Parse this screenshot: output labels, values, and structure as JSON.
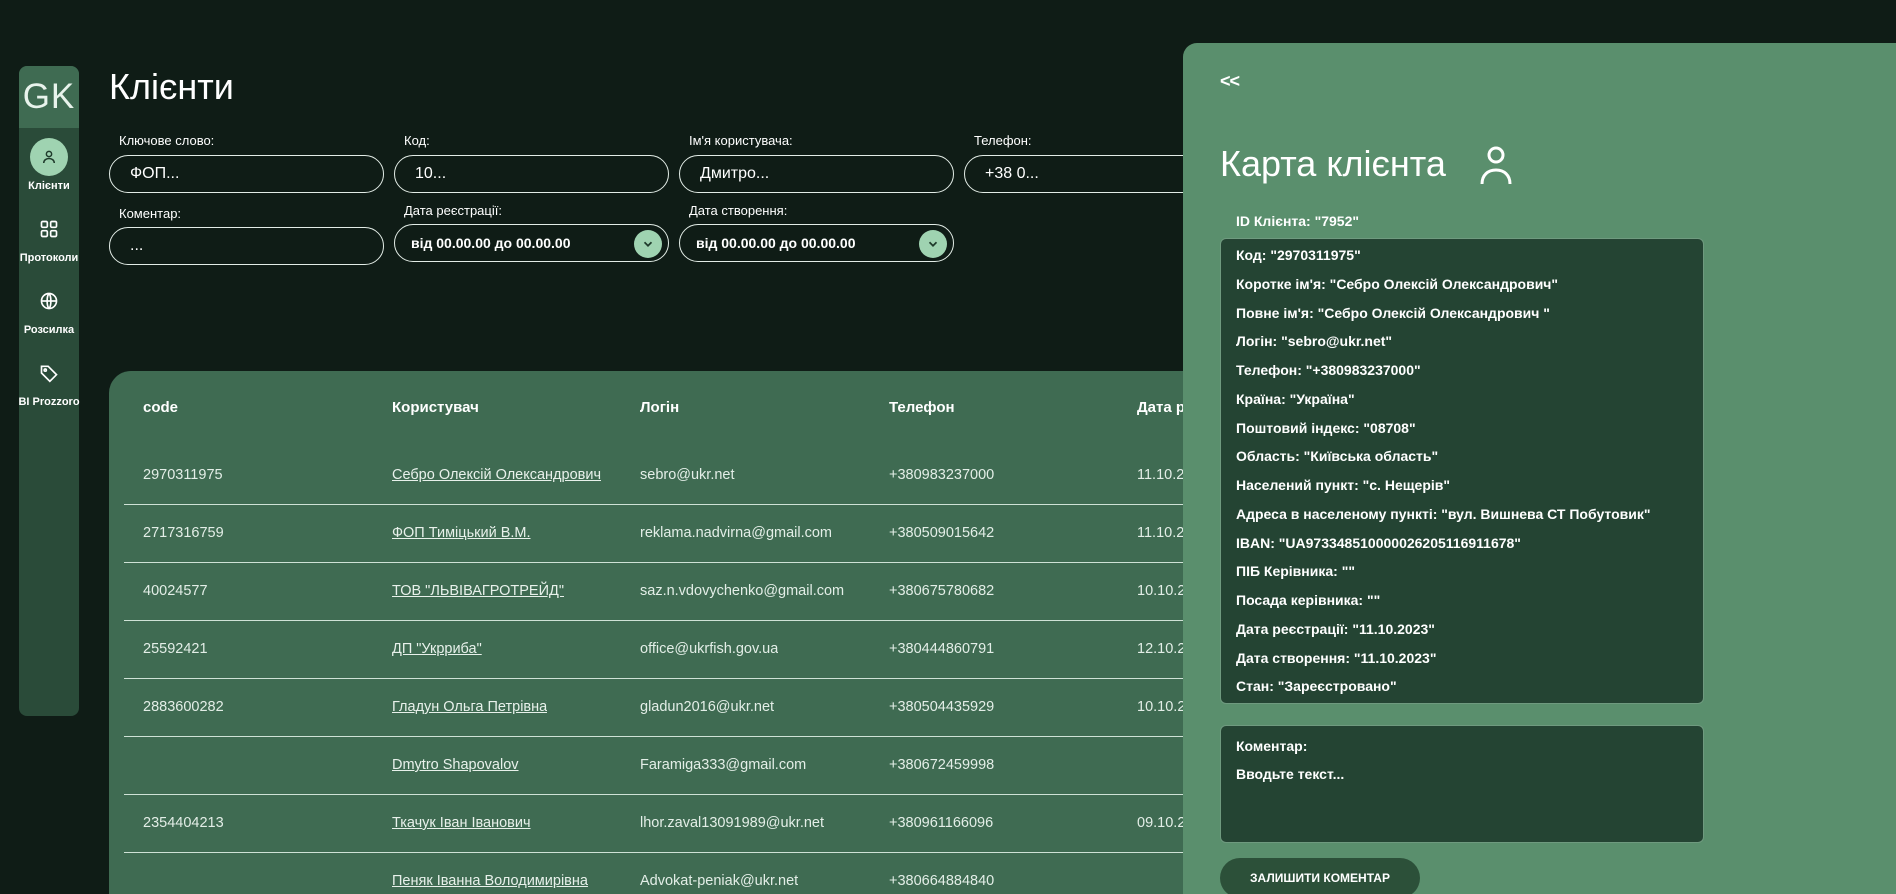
{
  "sidebar": {
    "logo": "GK",
    "items": [
      {
        "label": "Клієнти"
      },
      {
        "label": "Протоколи"
      },
      {
        "label": "Розсилка"
      },
      {
        "label": "BI Prozzoro"
      }
    ]
  },
  "page": {
    "title": "Клієнти"
  },
  "filters": {
    "keyword": {
      "label": "Ключове слово:",
      "placeholder": "ФОП..."
    },
    "code": {
      "label": "Код:",
      "placeholder": "10..."
    },
    "username": {
      "label": "Ім'я користувача:",
      "placeholder": "Дмитро..."
    },
    "phone": {
      "label": "Телефон:",
      "placeholder": "+38 0..."
    },
    "comment": {
      "label": "Коментар:",
      "placeholder": "..."
    },
    "reg_date": {
      "label": "Дата реєстрації:",
      "value": "від 00.00.00 до 00.00.00"
    },
    "created_date": {
      "label": "Дата створення:",
      "value": "від 00.00.00 до 00.00.00"
    }
  },
  "table": {
    "headers": [
      "code",
      "Користувач",
      "Логін",
      "Телефон",
      "Дата ре"
    ],
    "rows": [
      {
        "code": "2970311975",
        "user": "Себро Олексій Олександрович",
        "login": "sebro@ukr.net",
        "phone": "+380983237000",
        "date": "11.10.2"
      },
      {
        "code": "2717316759",
        "user": "ФОП Тиміцький В.М.",
        "login": "reklama.nadvirna@gmail.com",
        "phone": "+380509015642",
        "date": "11.10.2"
      },
      {
        "code": "40024577",
        "user": "ТОВ \"ЛЬВІВАГРОТРЕЙД\"",
        "login": "saz.n.vdovychenko@gmail.com",
        "phone": "+380675780682",
        "date": "10.10.2"
      },
      {
        "code": "25592421",
        "user": "ДП \"Укрриба\"",
        "login": "office@ukrfish.gov.ua",
        "phone": "+380444860791",
        "date": "12.10.2"
      },
      {
        "code": "2883600282",
        "user": "Гладун Ольга Петрівна",
        "login": "gladun2016@ukr.net",
        "phone": "+380504435929",
        "date": "10.10.2"
      },
      {
        "code": "",
        "user": "Dmytro Shapovalov",
        "login": "Faramiga333@gmail.com",
        "phone": "+380672459998",
        "date": ""
      },
      {
        "code": "2354404213",
        "user": "Ткачук Іван Іванович",
        "login": "lhor.zaval13091989@ukr.net",
        "phone": "+380961166096",
        "date": "09.10.2"
      },
      {
        "code": "",
        "user": "Пеняк Іванна Володимирівна",
        "login": "Advokat-peniak@ukr.net",
        "phone": "+380664884840",
        "date": ""
      }
    ]
  },
  "card": {
    "back": "<<",
    "title": "Карта клієнта",
    "client_id": "ID Клієнта: \"7952\"",
    "lines": [
      "Код: \"2970311975\"",
      "Коротке ім'я: \"Себро Олексій Олександрович\"",
      "Повне ім'я: \"Себро Олексій Олександрович \"",
      "Логін: \"sebro@ukr.net\"",
      "Телефон: \"+380983237000\"",
      "Країна: \"Україна\"",
      "Поштовий індекс: \"08708\"",
      "Область: \"Київська область\"",
      "Населений пункт: \"с. Нещерів\"",
      "Адреса в населеному пункті: \"вул. Вишнева СТ Побутовик\"",
      "IBAN: \"UA973348510000026205116911678\"",
      "ПІБ Керівника: \"\"",
      "Посада керівника: \"\"",
      "Дата реєстрації: \"11.10.2023\"",
      "Дата створення: \"11.10.2023\"",
      "Стан: \"Зареєстровано\""
    ],
    "comment_label": "Коментар:",
    "comment_placeholder": "Вводьте текст...",
    "comment_button": "ЗАЛИШИТИ КОМЕНТАР"
  },
  "colors": {
    "background": "#0f1c16",
    "sidebar": "#2a4b39",
    "table_panel": "#3f6b52",
    "card": "#5a8f6d",
    "info_box": "#244433",
    "accent": "#9fd3b1"
  }
}
